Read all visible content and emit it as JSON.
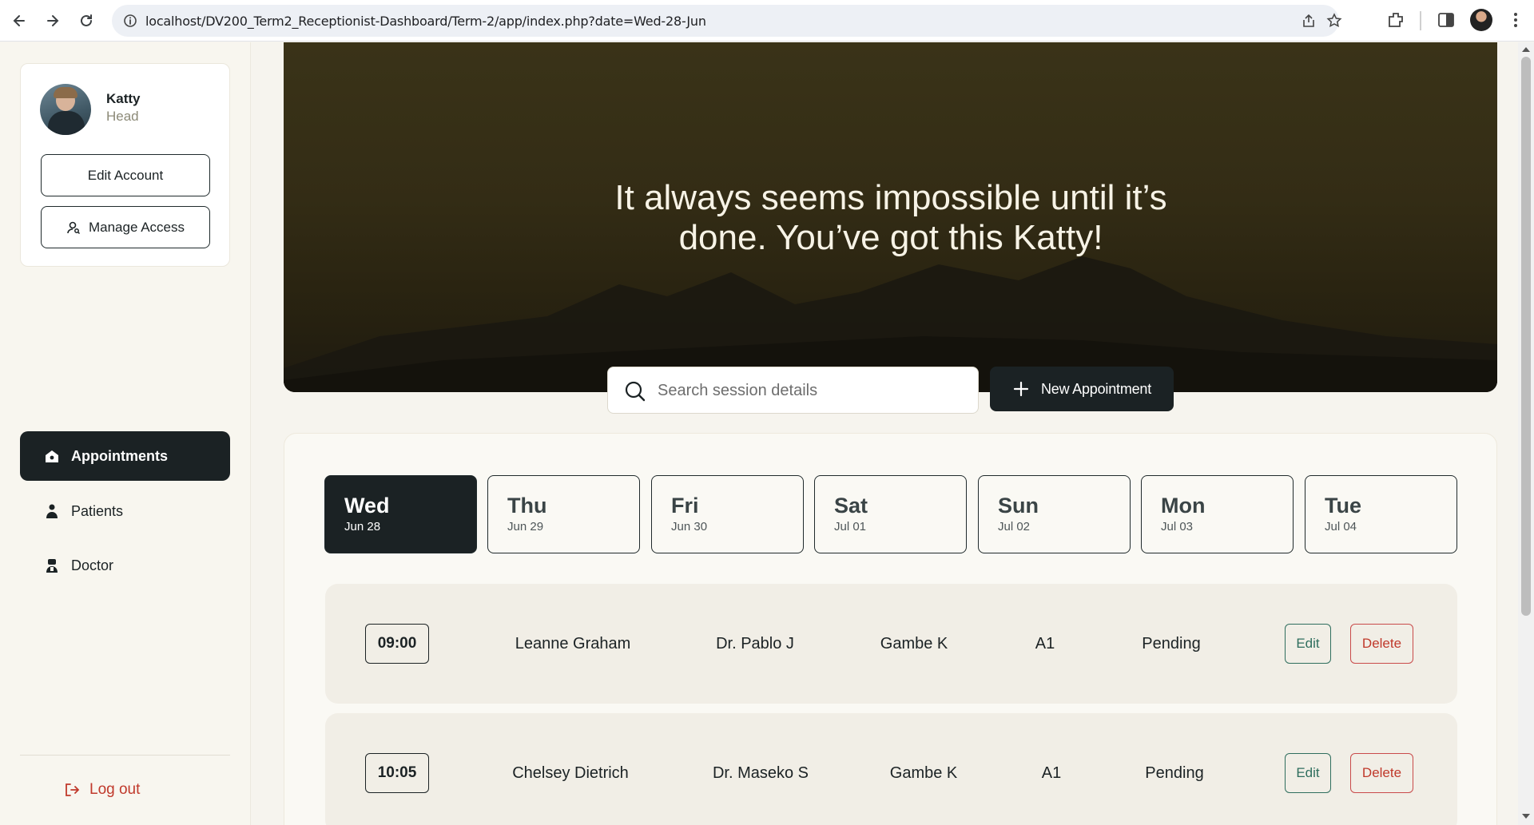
{
  "browser": {
    "url": "localhost/DV200_Term2_Receptionist-Dashboard/Term-2/app/index.php?date=Wed-28-Jun"
  },
  "user": {
    "name": "Katty",
    "role": "Head",
    "edit_account_label": "Edit Account",
    "manage_access_label": "Manage Access"
  },
  "nav": {
    "items": [
      {
        "label": "Appointments",
        "icon": "home-icon",
        "active": true
      },
      {
        "label": "Patients",
        "icon": "user-icon",
        "active": false
      },
      {
        "label": "Doctor",
        "icon": "doctor-icon",
        "active": false
      }
    ],
    "logout_label": "Log out"
  },
  "hero": {
    "quote": "It always seems impossible until it’s done. You’ve got this Katty!"
  },
  "search": {
    "placeholder": "Search session details",
    "value": ""
  },
  "new_appointment_label": "New Appointment",
  "days": [
    {
      "name": "Wed",
      "date": "Jun 28",
      "active": true
    },
    {
      "name": "Thu",
      "date": "Jun 29",
      "active": false
    },
    {
      "name": "Fri",
      "date": "Jun 30",
      "active": false
    },
    {
      "name": "Sat",
      "date": "Jul 01",
      "active": false
    },
    {
      "name": "Sun",
      "date": "Jul 02",
      "active": false
    },
    {
      "name": "Mon",
      "date": "Jul 03",
      "active": false
    },
    {
      "name": "Tue",
      "date": "Jul 04",
      "active": false
    }
  ],
  "appointments": [
    {
      "time": "09:00",
      "patient": "Leanne Graham",
      "doctor": "Dr. Pablo J",
      "receptionist": "Gambe K",
      "room": "A1",
      "status": "Pending",
      "edit_label": "Edit",
      "delete_label": "Delete"
    },
    {
      "time": "10:05",
      "patient": "Chelsey Dietrich",
      "doctor": "Dr. Maseko S",
      "receptionist": "Gambe K",
      "room": "A1",
      "status": "Pending",
      "edit_label": "Edit",
      "delete_label": "Delete"
    }
  ],
  "colors": {
    "primary_dark": "#1b2224",
    "edit": "#2f6e5e",
    "delete": "#c0392b",
    "role_text": "#8c8a78"
  }
}
